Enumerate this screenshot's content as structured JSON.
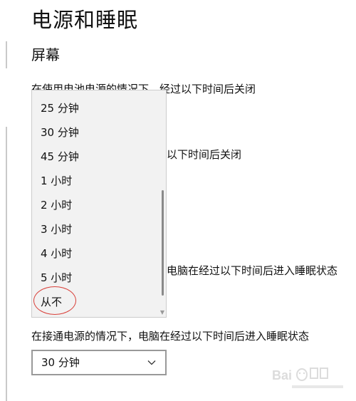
{
  "page": {
    "title": "电源和睡眠",
    "section": "屏幕"
  },
  "labels": {
    "screen_battery": "在使用电池电源的情况下，经过以下时间后关闭",
    "screen_plugged": "以下时间后关闭",
    "sleep_battery": "电脑在经过以下时间后进入睡眠状态",
    "sleep_plugged": "在接通电源的情况下，电脑在经过以下时间后进入睡眠状态"
  },
  "popup": {
    "options": [
      "25 分钟",
      "30 分钟",
      "45 分钟",
      "1 小时",
      "2 小时",
      "3 小时",
      "4 小时",
      "5 小时",
      "从不"
    ],
    "highlighted": "从不"
  },
  "dropdown": {
    "value": "30 分钟"
  },
  "colors": {
    "annotation_circle": "#d9403a",
    "popup_background": "#f2f2f2",
    "dropdown_border": "#999999"
  },
  "icons": {
    "dropdown": "chevron-down-icon",
    "scroll": "scroll-down-arrow-icon",
    "watermark": "baidu-jingyan-logo"
  }
}
